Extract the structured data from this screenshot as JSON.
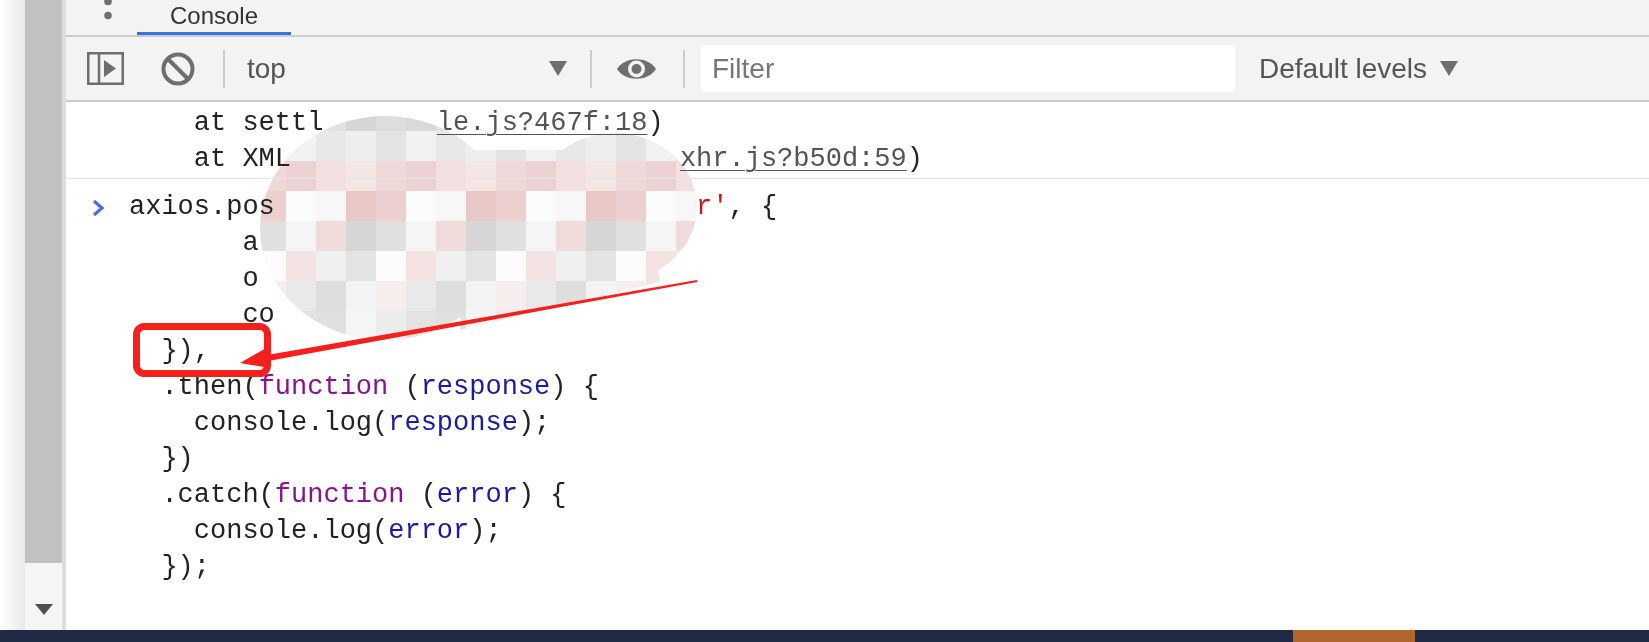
{
  "tabs": [
    {
      "label": "Console",
      "selected": true
    }
  ],
  "toolbar": {
    "context": "top",
    "filter": {
      "placeholder": "Filter"
    },
    "levels": "Default levels"
  },
  "console": {
    "messages": [
      {
        "kind": "stack_trace",
        "lines": [
          {
            "fragments": [
              {
                "tokens": [
                  {
                    "kind": "plain",
                    "text": "    at settl"
                  }
                ]
              },
              {
                "tokens": [
                  {
                    "kind": "link",
                    "text": "le.js?467f:18"
                  },
                  {
                    "kind": "plain",
                    "text": ")"
                  }
                ]
              }
            ]
          },
          {
            "fragments": [
              {
                "tokens": [
                  {
                    "kind": "plain",
                    "text": "    at XML"
                  }
                ]
              },
              {
                "tokens": [
                  {
                    "kind": "link",
                    "text": "xhr.js?b50d:59"
                  },
                  {
                    "kind": "plain",
                    "text": ")"
                  }
                ]
              }
            ]
          }
        ]
      },
      {
        "kind": "input",
        "lines": [
          {
            "fragments": [
              {
                "tokens": [
                  {
                    "kind": "plain",
                    "text": "axios.pos"
                  }
                ]
              },
              {
                "tokens": [
                  {
                    "kind": "string",
                    "text": "r'"
                  },
                  {
                    "kind": "plain",
                    "text": ", {"
                  }
                ]
              }
            ]
          },
          {
            "fragments": [
              {
                "tokens": [
                  {
                    "kind": "plain",
                    "text": "       a"
                  }
                ]
              }
            ]
          },
          {
            "fragments": [
              {
                "tokens": [
                  {
                    "kind": "plain",
                    "text": "       o"
                  }
                ]
              }
            ]
          },
          {
            "fragments": [
              {
                "tokens": [
                  {
                    "kind": "plain",
                    "text": "       co"
                  }
                ]
              }
            ]
          },
          {
            "fragments": [
              {
                "tokens": [
                  {
                    "kind": "plain",
                    "text": "  }),"
                  }
                ]
              }
            ]
          },
          {
            "fragments": [
              {
                "tokens": [
                  {
                    "kind": "plain",
                    "text": "  .then("
                  },
                  {
                    "kind": "keyword",
                    "text": "function"
                  },
                  {
                    "kind": "plain",
                    "text": " ("
                  },
                  {
                    "kind": "param",
                    "text": "response"
                  },
                  {
                    "kind": "plain",
                    "text": ") {"
                  }
                ]
              }
            ]
          },
          {
            "fragments": [
              {
                "tokens": [
                  {
                    "kind": "plain",
                    "text": "    console.log("
                  },
                  {
                    "kind": "param",
                    "text": "response"
                  },
                  {
                    "kind": "plain",
                    "text": ");"
                  }
                ]
              }
            ]
          },
          {
            "fragments": [
              {
                "tokens": [
                  {
                    "kind": "plain",
                    "text": "  })"
                  }
                ]
              }
            ]
          },
          {
            "fragments": [
              {
                "tokens": [
                  {
                    "kind": "plain",
                    "text": "  .catch("
                  },
                  {
                    "kind": "keyword",
                    "text": "function"
                  },
                  {
                    "kind": "plain",
                    "text": " ("
                  },
                  {
                    "kind": "param",
                    "text": "error"
                  },
                  {
                    "kind": "plain",
                    "text": ") {"
                  }
                ]
              }
            ]
          },
          {
            "fragments": [
              {
                "tokens": [
                  {
                    "kind": "plain",
                    "text": "    console.log("
                  },
                  {
                    "kind": "param",
                    "text": "error"
                  },
                  {
                    "kind": "plain",
                    "text": ");"
                  }
                ]
              }
            ]
          },
          {
            "fragments": [
              {
                "tokens": [
                  {
                    "kind": "plain",
                    "text": "  });"
                  }
                ]
              }
            ]
          }
        ]
      }
    ]
  }
}
